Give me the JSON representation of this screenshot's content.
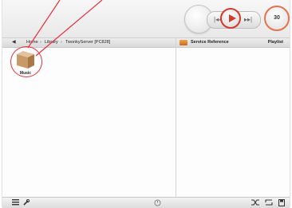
{
  "breadcrumb": {
    "home": "Home",
    "library": "Library",
    "server": "TwonkyServer [PC828]",
    "separator": "›"
  },
  "right_pane": {
    "service_reference": "Service Reference",
    "playlist": "Playlist"
  },
  "library_items": [
    {
      "label": "Music",
      "icon": "folder-icon"
    }
  ],
  "transport": {
    "volume_label": "30",
    "prev_icon": "skip-back-icon",
    "play_icon": "play-icon",
    "next_icon": "skip-forward-icon"
  },
  "bottom_bar_icons": [
    "list-view-icon",
    "settings-wrench-icon",
    "timer-icon",
    "shuffle-icon",
    "repeat-icon",
    "save-playlist-icon"
  ],
  "colors": {
    "accent_red": "#d43a2a",
    "annotation": "#e6303d",
    "folder_tan": "#c89a6a"
  }
}
